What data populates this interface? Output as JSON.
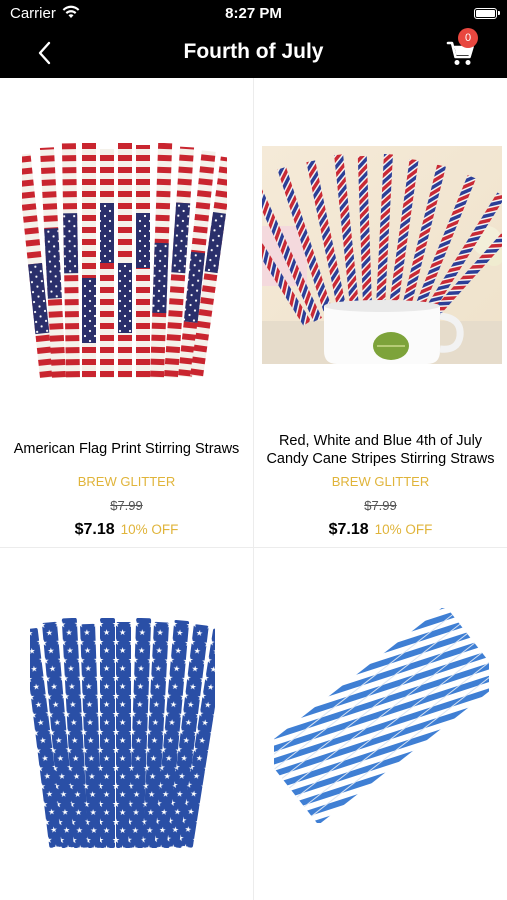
{
  "status_bar": {
    "carrier": "Carrier",
    "time": "8:27 PM"
  },
  "nav": {
    "title": "Fourth of July",
    "cart_count": "0",
    "back_icon": "chevron-left-icon",
    "cart_icon": "cart-icon"
  },
  "products": [
    {
      "name": "American Flag Print Stirring Straws",
      "brand": "BREW GLITTER",
      "original_price": "$7.99",
      "price": "$7.18",
      "discount": "10% OFF"
    },
    {
      "name": "Red, White and Blue 4th of July Candy Cane Stripes Stirring Straws",
      "brand": "BREW GLITTER",
      "original_price": "$7.99",
      "price": "$7.18",
      "discount": "10% OFF"
    }
  ],
  "colors": {
    "header_bg": "#000000",
    "accent_gold": "#e0b43a",
    "badge_red": "#e8473f"
  }
}
